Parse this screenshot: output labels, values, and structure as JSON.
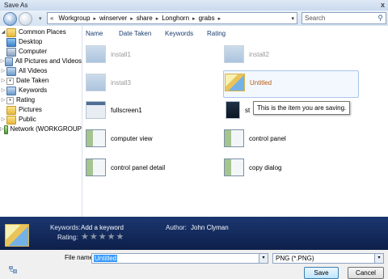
{
  "window": {
    "title": "Save As",
    "close_glyph": "x"
  },
  "nav": {
    "back_glyph": "‹",
    "forward_glyph": "›",
    "address_prefix": "«",
    "breadcrumb": [
      "Workgroup",
      "winserver",
      "share",
      "Longhorn",
      "grabs"
    ],
    "breadcrumb_sep": "▸",
    "search_placeholder": "Search",
    "search_icon": "search-icon"
  },
  "sidebar": {
    "items": [
      {
        "label": "Common Places",
        "icon": "folder-icon"
      },
      {
        "label": "Desktop",
        "icon": "desktop-icon"
      },
      {
        "label": "Computer",
        "icon": "computer-icon"
      },
      {
        "label": "All Pictures and Videos",
        "icon": "search-folder-icon"
      },
      {
        "label": "All Videos",
        "icon": "search-folder-icon"
      },
      {
        "label": "Date Taken",
        "icon": "dropdown-icon"
      },
      {
        "label": "Keywords",
        "icon": "search-folder-icon"
      },
      {
        "label": "Rating",
        "icon": "dropdown-icon"
      },
      {
        "label": "Pictures",
        "icon": "folder-icon"
      },
      {
        "label": "Public",
        "icon": "folder-icon"
      },
      {
        "label": "Network (WORKGROUP",
        "icon": "network-icon"
      }
    ]
  },
  "columns": [
    "Name",
    "Date Taken",
    "Keywords",
    "Rating"
  ],
  "files": [
    {
      "name": "install1",
      "style": "ghost"
    },
    {
      "name": "install2",
      "style": "ghost"
    },
    {
      "name": "install3",
      "style": "ghost"
    },
    {
      "name": "Untitled",
      "style": "accent"
    },
    {
      "name": "fullscreen1",
      "style": "normal"
    },
    {
      "name": "st",
      "style": "normal"
    },
    {
      "name": "computer view",
      "style": "normal"
    },
    {
      "name": "control panel",
      "style": "normal"
    },
    {
      "name": "control panel detail",
      "style": "normal"
    },
    {
      "name": "copy dialog",
      "style": "normal"
    }
  ],
  "tooltip": "This is the item you are saving.",
  "details": {
    "keywords_label": "Keywords:",
    "keywords_value": "Add a keyword",
    "rating_label": "Rating:",
    "rating_stars": 5,
    "rating_value": 0,
    "author_label": "Author:",
    "author_value": "John Clyman"
  },
  "form": {
    "filename_label": "File name:",
    "filename_value": "Untitled",
    "filetype_value": "PNG (*.PNG)",
    "save_label": "Save",
    "cancel_label": "Cancel"
  },
  "colors": {
    "details_bar": "#1b3770",
    "accent_text": "#b85a10",
    "link_header": "#1a3d6e"
  }
}
